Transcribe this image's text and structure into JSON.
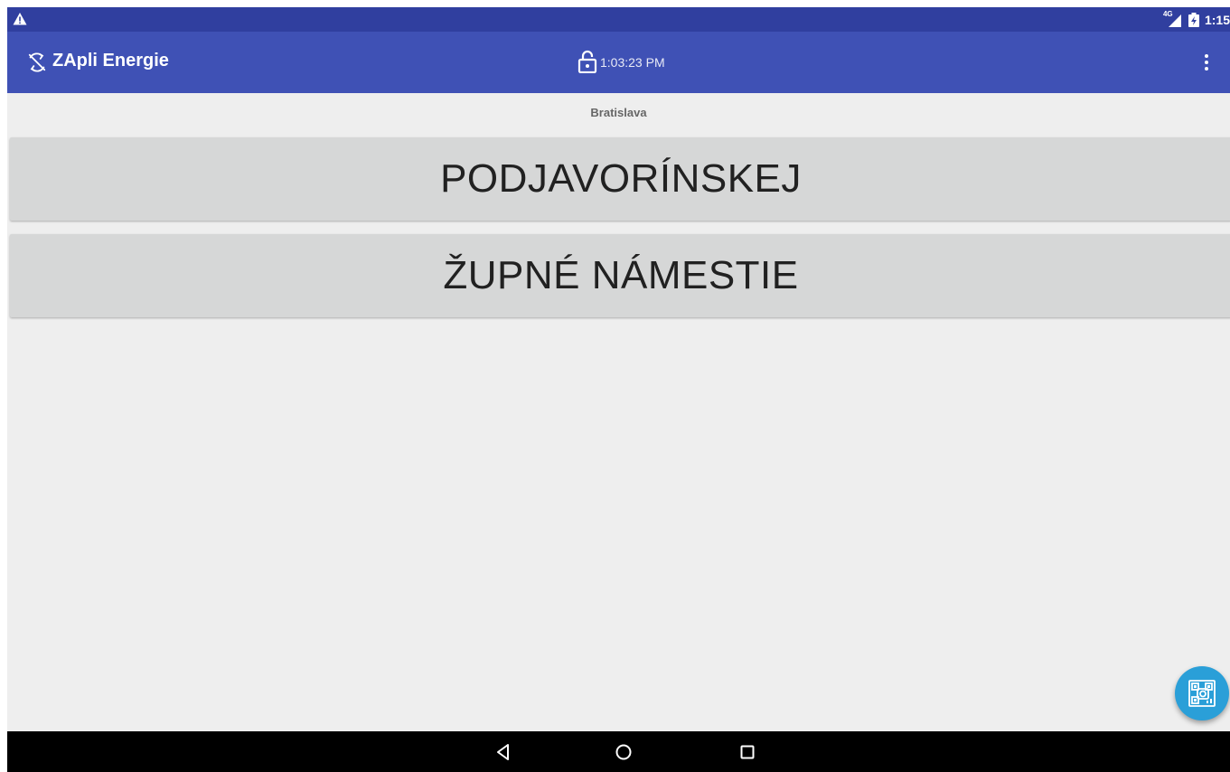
{
  "status_bar": {
    "network_type": "4G",
    "time": "1:15"
  },
  "app_bar": {
    "title": "ZApli Energie",
    "clock": "1:03:23 PM",
    "app_icon": "sync-disabled-icon",
    "lock_icon": "lock-open-icon",
    "menu_icon": "more-vert-icon"
  },
  "content": {
    "city": "Bratislava",
    "locations": [
      {
        "label": "PODJAVORÍNSKEJ"
      },
      {
        "label": "ŽUPNÉ NÁMESTIE"
      }
    ]
  },
  "fab": {
    "icon": "qr-scan-icon"
  },
  "nav_bar": {
    "back_icon": "back-icon",
    "home_icon": "home-icon",
    "recents_icon": "recents-icon"
  },
  "colors": {
    "status_bar": "#303f9f",
    "app_bar": "#3f51b5",
    "background": "#eeeeee",
    "button": "#d6d7d7",
    "fab": "#2a9fd8"
  }
}
